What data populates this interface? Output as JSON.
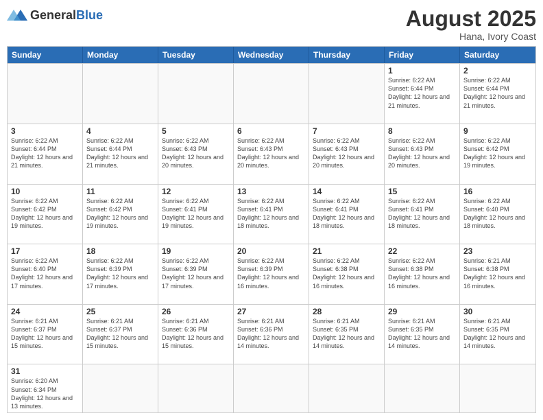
{
  "header": {
    "logo_general": "General",
    "logo_blue": "Blue",
    "month_title": "August 2025",
    "subtitle": "Hana, Ivory Coast"
  },
  "days_of_week": [
    "Sunday",
    "Monday",
    "Tuesday",
    "Wednesday",
    "Thursday",
    "Friday",
    "Saturday"
  ],
  "rows": [
    [
      {
        "day": "",
        "info": ""
      },
      {
        "day": "",
        "info": ""
      },
      {
        "day": "",
        "info": ""
      },
      {
        "day": "",
        "info": ""
      },
      {
        "day": "",
        "info": ""
      },
      {
        "day": "1",
        "info": "Sunrise: 6:22 AM\nSunset: 6:44 PM\nDaylight: 12 hours\nand 21 minutes."
      },
      {
        "day": "2",
        "info": "Sunrise: 6:22 AM\nSunset: 6:44 PM\nDaylight: 12 hours\nand 21 minutes."
      }
    ],
    [
      {
        "day": "3",
        "info": "Sunrise: 6:22 AM\nSunset: 6:44 PM\nDaylight: 12 hours\nand 21 minutes."
      },
      {
        "day": "4",
        "info": "Sunrise: 6:22 AM\nSunset: 6:44 PM\nDaylight: 12 hours\nand 21 minutes."
      },
      {
        "day": "5",
        "info": "Sunrise: 6:22 AM\nSunset: 6:43 PM\nDaylight: 12 hours\nand 20 minutes."
      },
      {
        "day": "6",
        "info": "Sunrise: 6:22 AM\nSunset: 6:43 PM\nDaylight: 12 hours\nand 20 minutes."
      },
      {
        "day": "7",
        "info": "Sunrise: 6:22 AM\nSunset: 6:43 PM\nDaylight: 12 hours\nand 20 minutes."
      },
      {
        "day": "8",
        "info": "Sunrise: 6:22 AM\nSunset: 6:43 PM\nDaylight: 12 hours\nand 20 minutes."
      },
      {
        "day": "9",
        "info": "Sunrise: 6:22 AM\nSunset: 6:42 PM\nDaylight: 12 hours\nand 19 minutes."
      }
    ],
    [
      {
        "day": "10",
        "info": "Sunrise: 6:22 AM\nSunset: 6:42 PM\nDaylight: 12 hours\nand 19 minutes."
      },
      {
        "day": "11",
        "info": "Sunrise: 6:22 AM\nSunset: 6:42 PM\nDaylight: 12 hours\nand 19 minutes."
      },
      {
        "day": "12",
        "info": "Sunrise: 6:22 AM\nSunset: 6:41 PM\nDaylight: 12 hours\nand 19 minutes."
      },
      {
        "day": "13",
        "info": "Sunrise: 6:22 AM\nSunset: 6:41 PM\nDaylight: 12 hours\nand 18 minutes."
      },
      {
        "day": "14",
        "info": "Sunrise: 6:22 AM\nSunset: 6:41 PM\nDaylight: 12 hours\nand 18 minutes."
      },
      {
        "day": "15",
        "info": "Sunrise: 6:22 AM\nSunset: 6:41 PM\nDaylight: 12 hours\nand 18 minutes."
      },
      {
        "day": "16",
        "info": "Sunrise: 6:22 AM\nSunset: 6:40 PM\nDaylight: 12 hours\nand 18 minutes."
      }
    ],
    [
      {
        "day": "17",
        "info": "Sunrise: 6:22 AM\nSunset: 6:40 PM\nDaylight: 12 hours\nand 17 minutes."
      },
      {
        "day": "18",
        "info": "Sunrise: 6:22 AM\nSunset: 6:39 PM\nDaylight: 12 hours\nand 17 minutes."
      },
      {
        "day": "19",
        "info": "Sunrise: 6:22 AM\nSunset: 6:39 PM\nDaylight: 12 hours\nand 17 minutes."
      },
      {
        "day": "20",
        "info": "Sunrise: 6:22 AM\nSunset: 6:39 PM\nDaylight: 12 hours\nand 16 minutes."
      },
      {
        "day": "21",
        "info": "Sunrise: 6:22 AM\nSunset: 6:38 PM\nDaylight: 12 hours\nand 16 minutes."
      },
      {
        "day": "22",
        "info": "Sunrise: 6:22 AM\nSunset: 6:38 PM\nDaylight: 12 hours\nand 16 minutes."
      },
      {
        "day": "23",
        "info": "Sunrise: 6:21 AM\nSunset: 6:38 PM\nDaylight: 12 hours\nand 16 minutes."
      }
    ],
    [
      {
        "day": "24",
        "info": "Sunrise: 6:21 AM\nSunset: 6:37 PM\nDaylight: 12 hours\nand 15 minutes."
      },
      {
        "day": "25",
        "info": "Sunrise: 6:21 AM\nSunset: 6:37 PM\nDaylight: 12 hours\nand 15 minutes."
      },
      {
        "day": "26",
        "info": "Sunrise: 6:21 AM\nSunset: 6:36 PM\nDaylight: 12 hours\nand 15 minutes."
      },
      {
        "day": "27",
        "info": "Sunrise: 6:21 AM\nSunset: 6:36 PM\nDaylight: 12 hours\nand 14 minutes."
      },
      {
        "day": "28",
        "info": "Sunrise: 6:21 AM\nSunset: 6:35 PM\nDaylight: 12 hours\nand 14 minutes."
      },
      {
        "day": "29",
        "info": "Sunrise: 6:21 AM\nSunset: 6:35 PM\nDaylight: 12 hours\nand 14 minutes."
      },
      {
        "day": "30",
        "info": "Sunrise: 6:21 AM\nSunset: 6:35 PM\nDaylight: 12 hours\nand 14 minutes."
      }
    ],
    [
      {
        "day": "31",
        "info": "Sunrise: 6:20 AM\nSunset: 6:34 PM\nDaylight: 12 hours\nand 13 minutes."
      },
      {
        "day": "",
        "info": ""
      },
      {
        "day": "",
        "info": ""
      },
      {
        "day": "",
        "info": ""
      },
      {
        "day": "",
        "info": ""
      },
      {
        "day": "",
        "info": ""
      },
      {
        "day": "",
        "info": ""
      }
    ]
  ]
}
